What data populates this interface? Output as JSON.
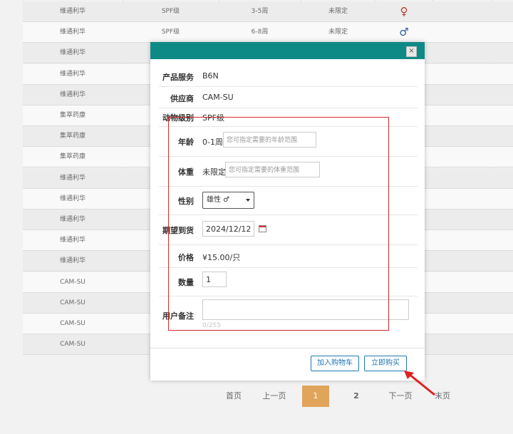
{
  "background_table": {
    "rows": [
      {
        "supplier": "维通利华",
        "level": "SPF级",
        "age": "3-5周",
        "weight": "未限定",
        "sex": "female"
      },
      {
        "supplier": "维通利华",
        "level": "SPF级",
        "age": "6-8周",
        "weight": "未限定",
        "sex": "male"
      },
      {
        "supplier": "维通利华",
        "level": "",
        "age": "",
        "weight": "",
        "sex": ""
      },
      {
        "supplier": "维通利华",
        "level": "",
        "age": "",
        "weight": "",
        "sex": ""
      },
      {
        "supplier": "维通利华",
        "level": "",
        "age": "",
        "weight": "",
        "sex": ""
      },
      {
        "supplier": "集萃药康",
        "level": "",
        "age": "",
        "weight": "",
        "sex": ""
      },
      {
        "supplier": "集萃药康",
        "level": "",
        "age": "",
        "weight": "",
        "sex": ""
      },
      {
        "supplier": "集萃药康",
        "level": "",
        "age": "",
        "weight": "",
        "sex": ""
      },
      {
        "supplier": "维通利华",
        "level": "",
        "age": "",
        "weight": "",
        "sex": ""
      },
      {
        "supplier": "维通利华",
        "level": "",
        "age": "",
        "weight": "",
        "sex": ""
      },
      {
        "supplier": "维通利华",
        "level": "",
        "age": "",
        "weight": "",
        "sex": ""
      },
      {
        "supplier": "维通利华",
        "level": "",
        "age": "",
        "weight": "",
        "sex": ""
      },
      {
        "supplier": "维通利华",
        "level": "",
        "age": "",
        "weight": "",
        "sex": ""
      },
      {
        "supplier": "CAM-SU",
        "level": "",
        "age": "",
        "weight": "",
        "sex": ""
      },
      {
        "supplier": "CAM-SU",
        "level": "",
        "age": "",
        "weight": "",
        "sex": ""
      },
      {
        "supplier": "CAM-SU",
        "level": "",
        "age": "",
        "weight": "",
        "sex": ""
      },
      {
        "supplier": "CAM-SU",
        "level": "",
        "age": "",
        "weight": "",
        "sex": ""
      }
    ],
    "female_symbol": "♀",
    "male_symbol": "♂"
  },
  "pagination": {
    "first": "首页",
    "prev": "上一页",
    "pages": [
      "1",
      "2"
    ],
    "current": "1",
    "next": "下一页",
    "last": "末页"
  },
  "modal": {
    "close_symbol": "×",
    "fields": {
      "product_label": "产品服务",
      "product_value": "B6N",
      "supplier_label": "供应商",
      "supplier_value": "CAM-SU",
      "level_label": "动物级别",
      "level_value": "SPF级",
      "age_label": "年龄",
      "age_value": "0-1周",
      "age_placeholder": "您可指定需要的年龄范围",
      "weight_label": "体重",
      "weight_value": "未限定",
      "weight_placeholder": "您可指定需要的体重范围",
      "sex_label": "性别",
      "sex_selected": "雄性 ♂",
      "date_label": "期望到货",
      "date_value": "2024/12/12",
      "price_label": "价格",
      "price_value": "¥15.00/只",
      "qty_label": "数量",
      "qty_value": "1",
      "note_label": "用户备注",
      "note_counter": "0/255"
    },
    "buttons": {
      "add_cart": "加入购物车",
      "buy_now": "立即购买"
    }
  },
  "colors": {
    "modal_header": "#0e8a86",
    "annotation_red": "#d42a2a",
    "pager_active": "#e0a45a",
    "button_blue": "#1f78b4"
  }
}
